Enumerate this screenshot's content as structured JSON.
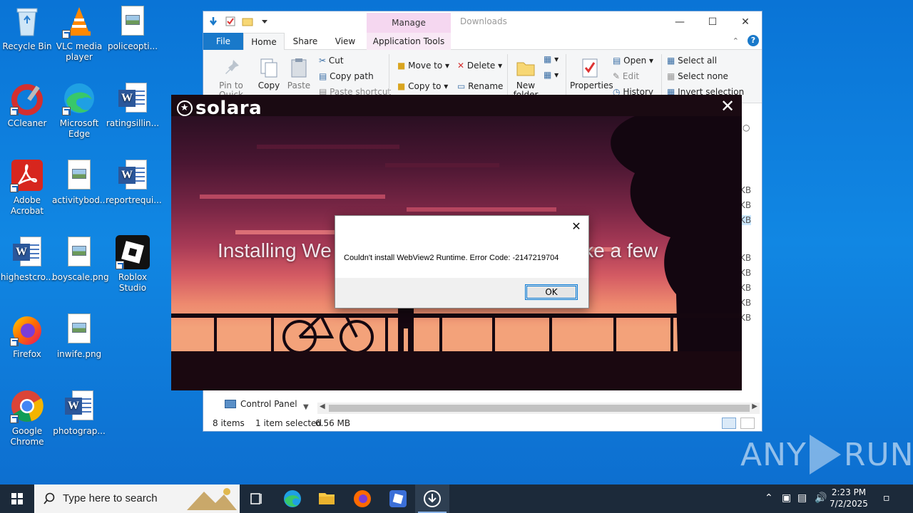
{
  "desktop": {
    "icons": [
      {
        "label": "Recycle Bin",
        "icon": "recycle-bin-icon"
      },
      {
        "label": "VLC media player",
        "icon": "vlc-icon"
      },
      {
        "label": "policeopti...",
        "icon": "image-file-icon"
      },
      {
        "label": "CCleaner",
        "icon": "ccleaner-icon"
      },
      {
        "label": "Microsoft Edge",
        "icon": "edge-icon"
      },
      {
        "label": "ratingsillin...",
        "icon": "word-doc-icon"
      },
      {
        "label": "Adobe Acrobat",
        "icon": "acrobat-icon"
      },
      {
        "label": "activitybod...",
        "icon": "image-file-icon"
      },
      {
        "label": "reportrequi...",
        "icon": "word-doc-icon"
      },
      {
        "label": "highestcro...",
        "icon": "word-doc-icon"
      },
      {
        "label": "boyscale.png",
        "icon": "image-file-icon"
      },
      {
        "label": "Roblox Studio",
        "icon": "roblox-studio-icon"
      },
      {
        "label": "Firefox",
        "icon": "firefox-icon"
      },
      {
        "label": "inwife.png",
        "icon": "image-file-icon"
      },
      {
        "label": "Google Chrome",
        "icon": "chrome-icon"
      },
      {
        "label": "photograp...",
        "icon": "word-doc-icon"
      }
    ]
  },
  "explorer": {
    "title": "Downloads",
    "manage_label": "Manage",
    "tabs": [
      "File",
      "Home",
      "Share",
      "View",
      "Application Tools"
    ],
    "ribbon": {
      "pin": "Pin to Quick access",
      "copy": "Copy",
      "paste": "Paste",
      "cut": "Cut",
      "copy_path": "Copy path",
      "paste_shortcut": "Paste shortcut",
      "move_to": "Move to",
      "copy_to": "Copy to",
      "delete": "Delete",
      "rename": "Rename",
      "new_folder": "New folder",
      "properties": "Properties",
      "open": "Open",
      "edit": "Edit",
      "history": "History",
      "select_all": "Select all",
      "select_none": "Select none",
      "invert_selection": "Invert selection"
    },
    "nav_item": "Control Panel",
    "size_suffix": "KB",
    "status": {
      "items": "8 items",
      "selected": "1 item selected",
      "size": "6.56 MB"
    }
  },
  "solara": {
    "title": "solara",
    "install_text": "Installing We",
    "install_text_tail": "y take a few"
  },
  "dialog": {
    "message": "Couldn't install WebView2 Runtime. Error Code: -2147219704",
    "ok_label": "OK"
  },
  "watermark": {
    "left": "ANY",
    "right": "RUN"
  },
  "taskbar": {
    "search_placeholder": "Type here to search",
    "time": "2:23 PM",
    "date": "7/2/2025"
  }
}
